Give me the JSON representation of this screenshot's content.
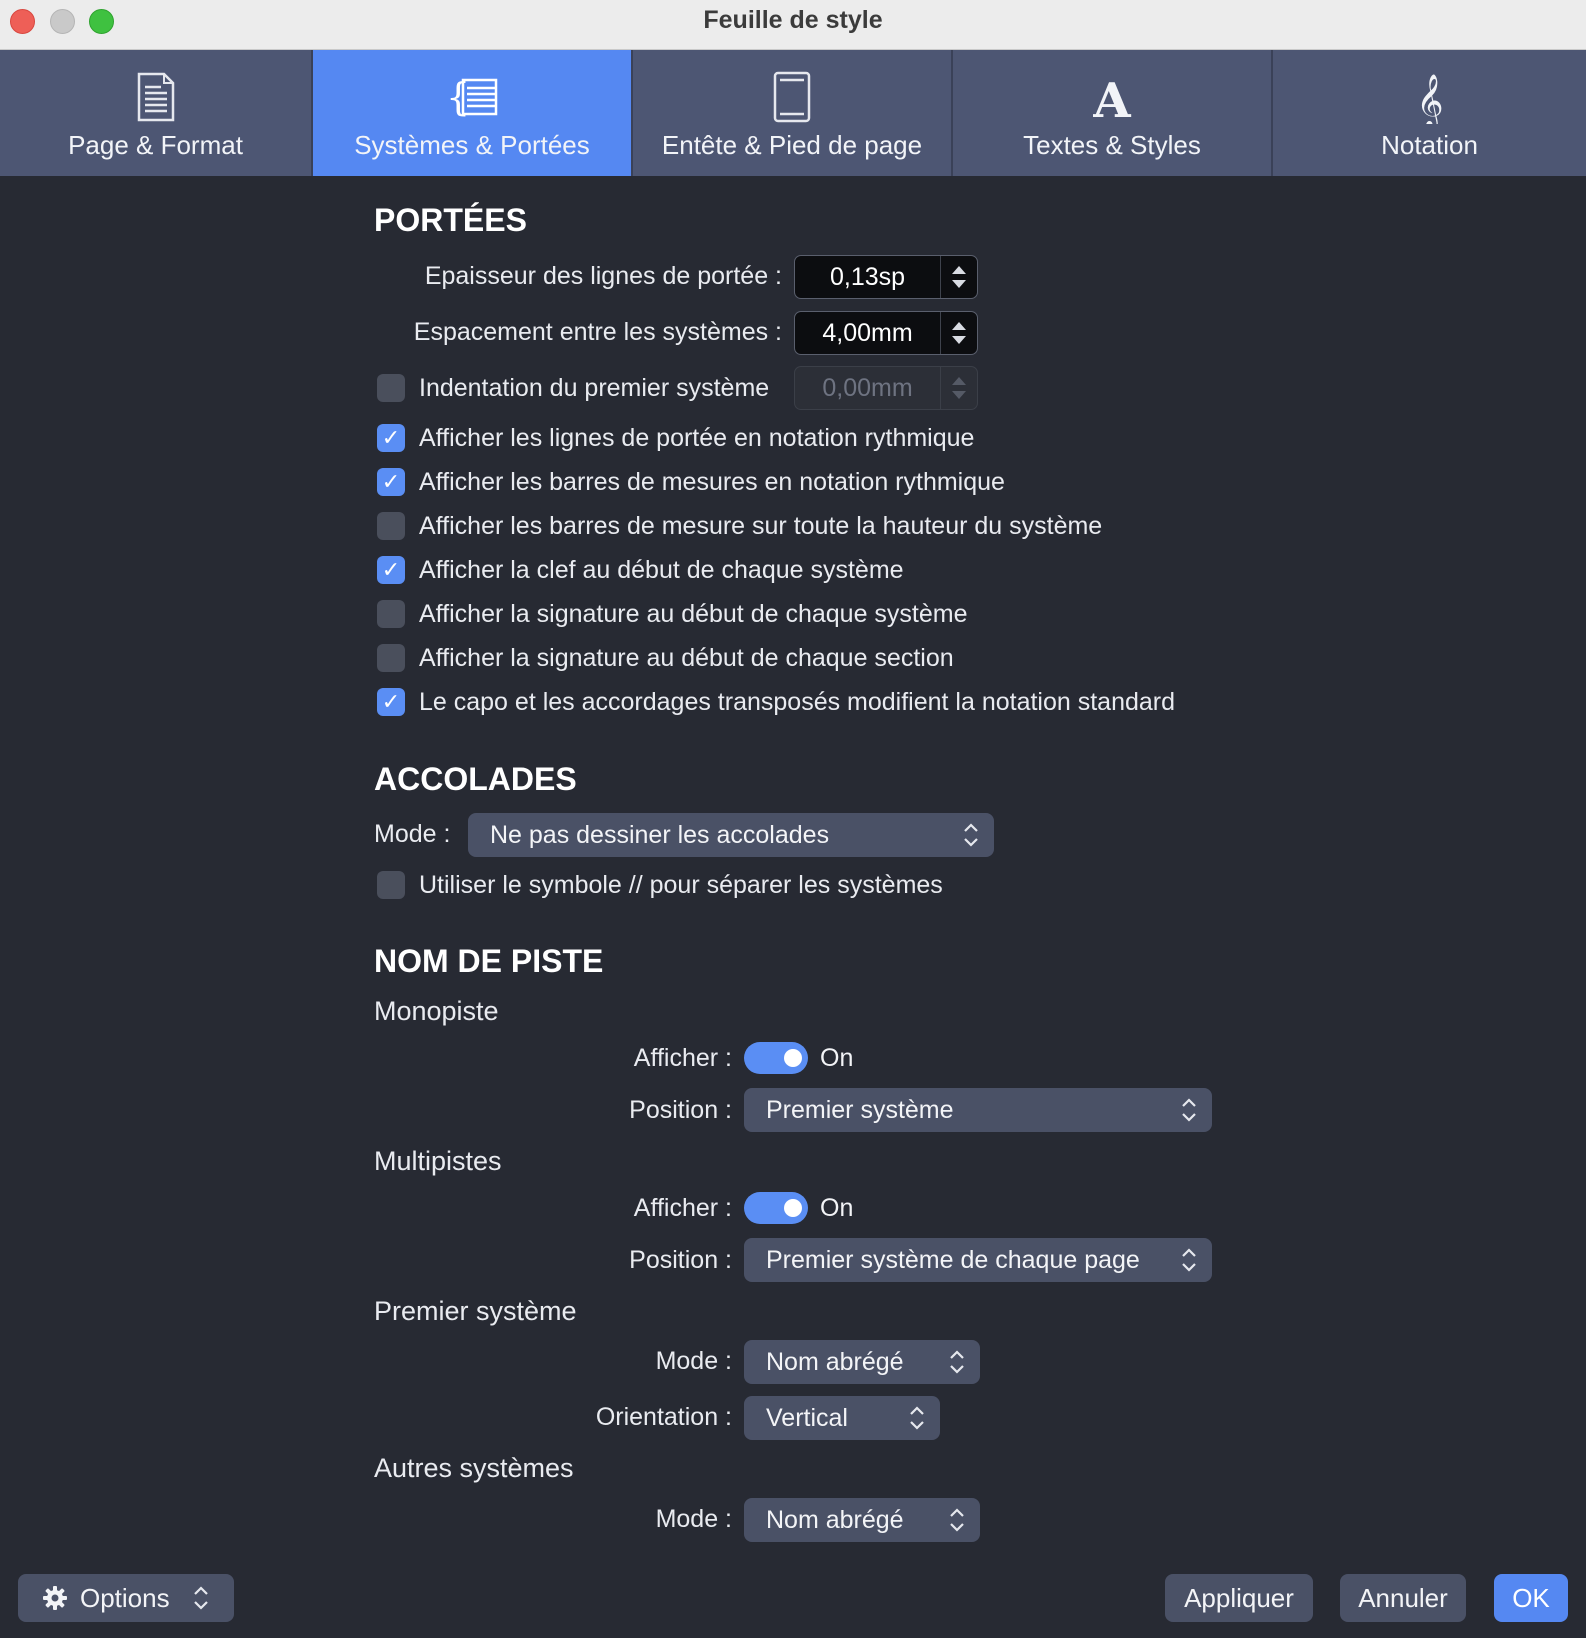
{
  "window": {
    "title": "Feuille de style"
  },
  "tabs": [
    {
      "label": "Page & Format",
      "icon": "page-icon",
      "active": false
    },
    {
      "label": "Systèmes & Portées",
      "icon": "systems-icon",
      "active": true
    },
    {
      "label": "Entête & Pied de page",
      "icon": "header-footer-icon",
      "active": false
    },
    {
      "label": "Textes & Styles",
      "icon": "text-icon",
      "active": false
    },
    {
      "label": "Notation",
      "icon": "treble-clef-icon",
      "active": false
    }
  ],
  "portees": {
    "title": "PORTÉES",
    "line_thickness": {
      "label": "Epaisseur des lignes de portée :",
      "value": "0,13sp"
    },
    "system_spacing": {
      "label": "Espacement entre les systèmes :",
      "value": "4,00mm"
    },
    "first_indent": {
      "label": "Indentation du premier système",
      "value": "0,00mm",
      "checked": false
    },
    "checkboxes": [
      {
        "label": "Afficher les lignes de portée en notation rythmique",
        "checked": true
      },
      {
        "label": "Afficher les barres de mesures en notation rythmique",
        "checked": true
      },
      {
        "label": "Afficher les barres de mesure sur toute la hauteur du système",
        "checked": false
      },
      {
        "label": "Afficher la clef au début de chaque système",
        "checked": true
      },
      {
        "label": "Afficher la signature au début de chaque système",
        "checked": false
      },
      {
        "label": "Afficher la signature au début de chaque section",
        "checked": false
      },
      {
        "label": "Le capo et les accordages transposés modifient la notation standard",
        "checked": true
      }
    ]
  },
  "accolades": {
    "title": "ACCOLADES",
    "mode_label": "Mode :",
    "mode_value": "Ne pas dessiner les accolades",
    "separator": {
      "label": "Utiliser le symbole // pour séparer les systèmes",
      "checked": false
    }
  },
  "nom_de_piste": {
    "title": "NOM DE PISTE",
    "monopiste": {
      "title": "Monopiste",
      "show_label": "Afficher :",
      "show_value": "On",
      "position_label": "Position :",
      "position_value": "Premier système"
    },
    "multipistes": {
      "title": "Multipistes",
      "show_label": "Afficher :",
      "show_value": "On",
      "position_label": "Position :",
      "position_value": "Premier système de chaque page"
    },
    "premier_systeme": {
      "title": "Premier système",
      "mode_label": "Mode :",
      "mode_value": "Nom abrégé",
      "orientation_label": "Orientation :",
      "orientation_value": "Vertical"
    },
    "autres_systemes": {
      "title": "Autres systèmes",
      "mode_label": "Mode :",
      "mode_value": "Nom abrégé"
    }
  },
  "footer": {
    "options_label": "Options",
    "apply_label": "Appliquer",
    "cancel_label": "Annuler",
    "ok_label": "OK"
  },
  "colors": {
    "accent": "#5588f2",
    "background": "#272a33",
    "tabbar": "#4d5673"
  }
}
